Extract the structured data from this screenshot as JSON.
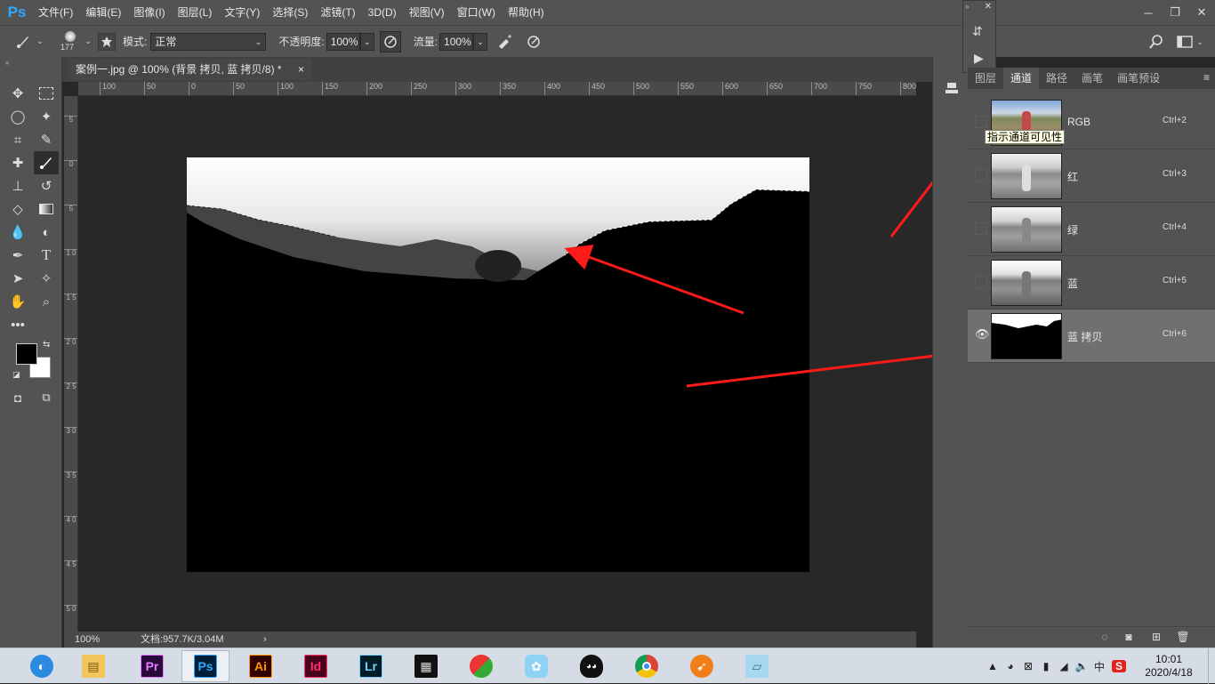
{
  "menubar": {
    "logo": "Ps",
    "items": [
      "文件(F)",
      "编辑(E)",
      "图像(I)",
      "图层(L)",
      "文字(Y)",
      "选择(S)",
      "滤镜(T)",
      "3D(D)",
      "视图(V)",
      "窗口(W)",
      "帮助(H)"
    ]
  },
  "options": {
    "brush_size": "177",
    "mode_label": "模式:",
    "mode_value": "正常",
    "opacity_label": "不透明度:",
    "opacity_value": "100%",
    "flow_label": "流量:",
    "flow_value": "100%"
  },
  "document": {
    "tab_title": "案例一.jpg @ 100% (背景 拷贝, 蓝 拷贝/8) *",
    "close": "×",
    "zoom": "100%",
    "doc_info": "文档:957.7K/3.04M",
    "status_arrow": "›",
    "hruler_labels": [
      "100",
      "50",
      "0",
      "50",
      "100",
      "150",
      "200",
      "250",
      "300",
      "350",
      "400",
      "450",
      "500",
      "550",
      "600",
      "650",
      "700",
      "750",
      "800"
    ],
    "vruler_labels": [
      "5",
      "0",
      "5",
      "1 0",
      "1 5",
      "2 0",
      "2 5",
      "3 0",
      "3 5",
      "4 0",
      "4 5",
      "5 0",
      "5 5",
      "6 0"
    ]
  },
  "panel": {
    "tabs": [
      "图层",
      "通道",
      "路径",
      "画笔",
      "画笔预设"
    ],
    "active_tab": "通道",
    "channels": [
      {
        "name": "RGB",
        "shortcut": "Ctrl+2",
        "visible": false
      },
      {
        "name": "红",
        "shortcut": "Ctrl+3",
        "visible": false
      },
      {
        "name": "绿",
        "shortcut": "Ctrl+4",
        "visible": false
      },
      {
        "name": "蓝",
        "shortcut": "Ctrl+5",
        "visible": false
      },
      {
        "name": "蓝 拷贝",
        "shortcut": "Ctrl+6",
        "visible": true
      }
    ],
    "tooltip": "指示通道可见性"
  },
  "taskbar": {
    "apps": [
      {
        "name": "edge",
        "label": ""
      },
      {
        "name": "explorer",
        "label": ""
      },
      {
        "name": "premiere",
        "label": "Pr"
      },
      {
        "name": "photoshop",
        "label": "Ps"
      },
      {
        "name": "illustrator",
        "label": "Ai"
      },
      {
        "name": "indesign",
        "label": "Id"
      },
      {
        "name": "lightroom",
        "label": "Lr"
      },
      {
        "name": "video",
        "label": ""
      },
      {
        "name": "umbrella",
        "label": ""
      },
      {
        "name": "bird",
        "label": ""
      },
      {
        "name": "qq",
        "label": ""
      },
      {
        "name": "chrome",
        "label": ""
      },
      {
        "name": "foxmail",
        "label": ""
      },
      {
        "name": "notepad",
        "label": ""
      }
    ],
    "ime": "中",
    "time": "10:01",
    "date": "2020/4/18"
  },
  "colors": {
    "accent_ps": "#31a8ff",
    "arrow": "#ff1a1a"
  }
}
